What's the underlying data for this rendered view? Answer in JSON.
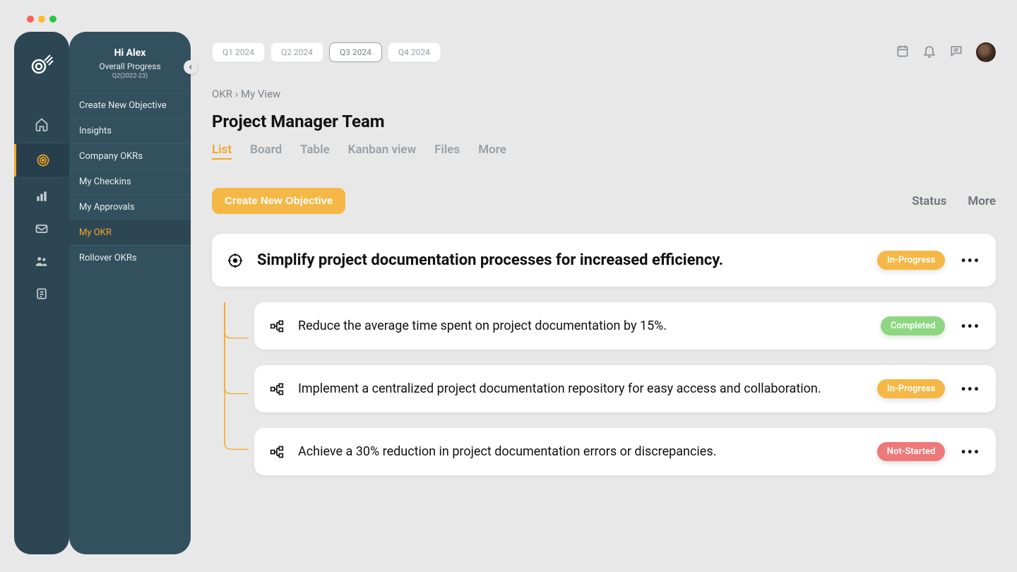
{
  "sidebar": {
    "greeting": "Hi Alex",
    "subtitle": "Overall Progress",
    "period": "Q2(2022-23)",
    "items": [
      {
        "label": "Create New Objective"
      },
      {
        "label": "Insights"
      },
      {
        "label": "Company OKRs"
      },
      {
        "label": "My  Checkins"
      },
      {
        "label": "My Approvals"
      },
      {
        "label": "My OKR"
      },
      {
        "label": "Rollover OKRs"
      }
    ],
    "active_index": 5
  },
  "quarters": [
    "Q1 2024",
    "Q2 2024",
    "Q3 2024",
    "Q4 2024"
  ],
  "quarter_active": 2,
  "breadcrumb": {
    "root": "OKR",
    "sep": "›",
    "leaf": "My View"
  },
  "page_title": "Project Manager Team",
  "viewtabs": [
    "List",
    "Board",
    "Table",
    "Kanban view",
    "Files",
    "More"
  ],
  "viewtab_active": 0,
  "cta_label": "Create New Objective",
  "right_controls": [
    "Status",
    "More"
  ],
  "objective": {
    "title": "Simplify project documentation processes for increased efficiency.",
    "status": "In-Progress"
  },
  "key_results": [
    {
      "text": "Reduce the average time spent on project documentation by 15%.",
      "status": "Completed",
      "status_class": "done"
    },
    {
      "text": "Implement a centralized project documentation repository for easy access and collaboration.",
      "status": "In-Progress",
      "status_class": "inprog"
    },
    {
      "text": "Achieve a 30% reduction in project documentation errors or discrepancies.",
      "status": "Not-Started",
      "status_class": "notstart"
    }
  ]
}
